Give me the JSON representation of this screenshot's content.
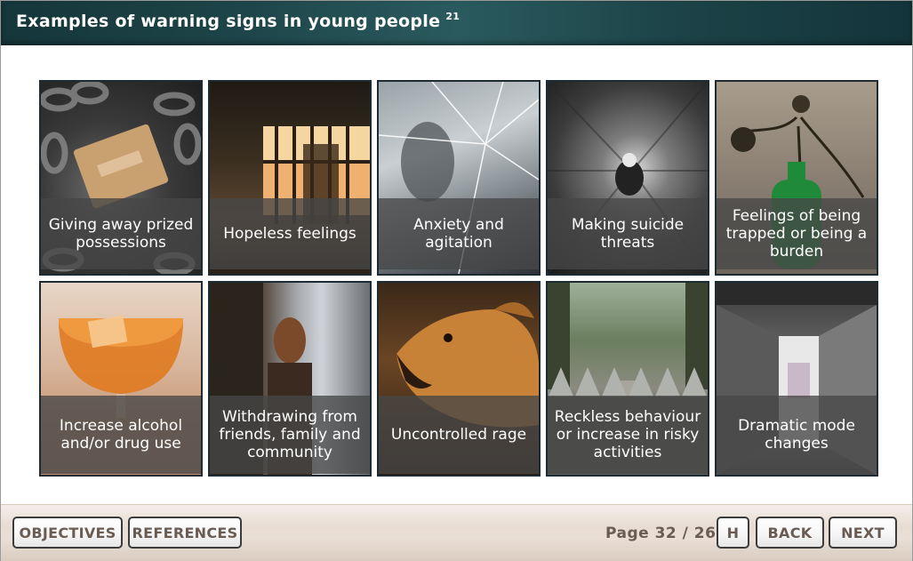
{
  "header": {
    "title": "Examples of warning signs in young people",
    "footnote": "21"
  },
  "tiles": [
    {
      "caption": "Giving away prized possessions",
      "image": "chains-and-padlock"
    },
    {
      "caption": "Hopeless feelings",
      "image": "barred-window-sunset"
    },
    {
      "caption": "Anxiety and agitation",
      "image": "shattered-glass"
    },
    {
      "caption": "Making suicide threats",
      "image": "radial-blur-figure"
    },
    {
      "caption": "Feelings of being trapped or being a burden",
      "image": "dried-flowers-in-green-bottle"
    },
    {
      "caption": "Increase alcohol and/or drug use",
      "image": "glass-of-liquor"
    },
    {
      "caption": "Withdrawing from friends, family and community",
      "image": "woman-leaning-on-tree"
    },
    {
      "caption": "Uncontrolled rage",
      "image": "snarling-dog"
    },
    {
      "caption": "Reckless behaviour or increase in risky activities",
      "image": "spiked-wall-and-path"
    },
    {
      "caption": "Dramatic mode changes",
      "image": "concrete-corridor"
    }
  ],
  "footer": {
    "objectives_label": "OBJECTIVES",
    "references_label": "REFERENCES",
    "page_indicator": "Page 32 / 26",
    "home_label": "H",
    "back_label": "BACK",
    "next_label": "NEXT"
  }
}
